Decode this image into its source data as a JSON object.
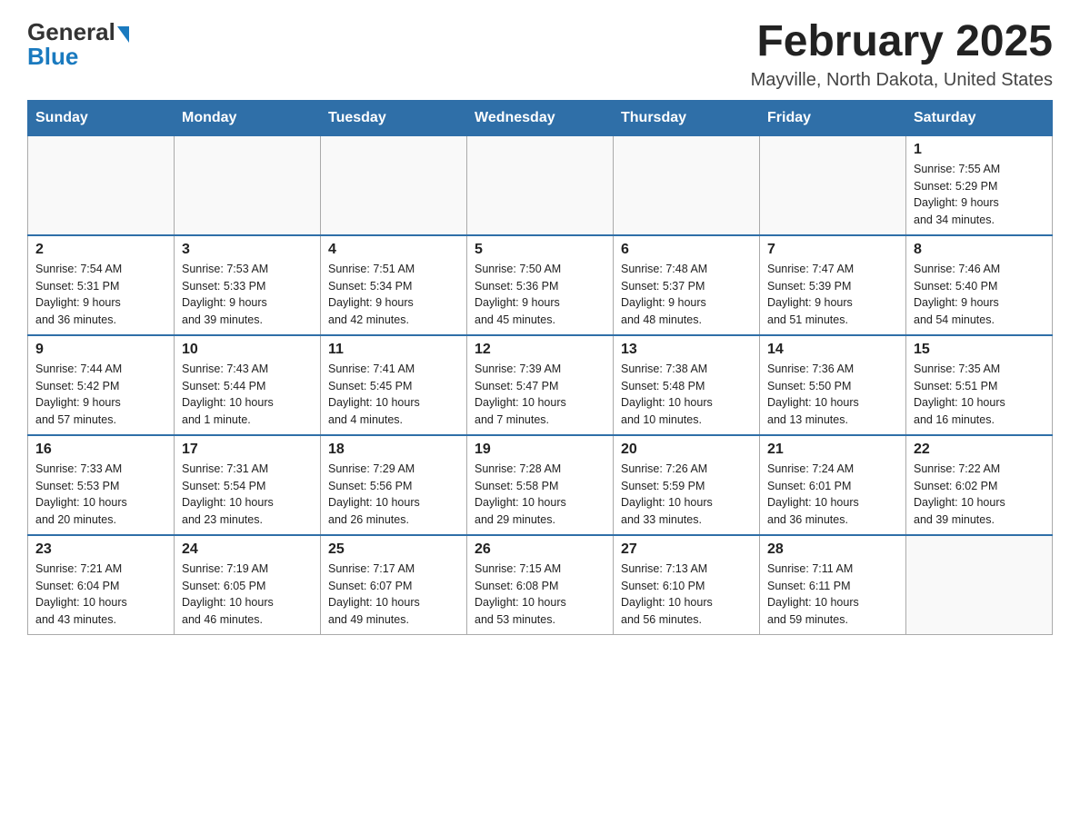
{
  "header": {
    "logo_line1": "General",
    "logo_line2": "Blue",
    "title": "February 2025",
    "location": "Mayville, North Dakota, United States"
  },
  "weekdays": [
    "Sunday",
    "Monday",
    "Tuesday",
    "Wednesday",
    "Thursday",
    "Friday",
    "Saturday"
  ],
  "weeks": [
    [
      {
        "day": "",
        "info": ""
      },
      {
        "day": "",
        "info": ""
      },
      {
        "day": "",
        "info": ""
      },
      {
        "day": "",
        "info": ""
      },
      {
        "day": "",
        "info": ""
      },
      {
        "day": "",
        "info": ""
      },
      {
        "day": "1",
        "info": "Sunrise: 7:55 AM\nSunset: 5:29 PM\nDaylight: 9 hours\nand 34 minutes."
      }
    ],
    [
      {
        "day": "2",
        "info": "Sunrise: 7:54 AM\nSunset: 5:31 PM\nDaylight: 9 hours\nand 36 minutes."
      },
      {
        "day": "3",
        "info": "Sunrise: 7:53 AM\nSunset: 5:33 PM\nDaylight: 9 hours\nand 39 minutes."
      },
      {
        "day": "4",
        "info": "Sunrise: 7:51 AM\nSunset: 5:34 PM\nDaylight: 9 hours\nand 42 minutes."
      },
      {
        "day": "5",
        "info": "Sunrise: 7:50 AM\nSunset: 5:36 PM\nDaylight: 9 hours\nand 45 minutes."
      },
      {
        "day": "6",
        "info": "Sunrise: 7:48 AM\nSunset: 5:37 PM\nDaylight: 9 hours\nand 48 minutes."
      },
      {
        "day": "7",
        "info": "Sunrise: 7:47 AM\nSunset: 5:39 PM\nDaylight: 9 hours\nand 51 minutes."
      },
      {
        "day": "8",
        "info": "Sunrise: 7:46 AM\nSunset: 5:40 PM\nDaylight: 9 hours\nand 54 minutes."
      }
    ],
    [
      {
        "day": "9",
        "info": "Sunrise: 7:44 AM\nSunset: 5:42 PM\nDaylight: 9 hours\nand 57 minutes."
      },
      {
        "day": "10",
        "info": "Sunrise: 7:43 AM\nSunset: 5:44 PM\nDaylight: 10 hours\nand 1 minute."
      },
      {
        "day": "11",
        "info": "Sunrise: 7:41 AM\nSunset: 5:45 PM\nDaylight: 10 hours\nand 4 minutes."
      },
      {
        "day": "12",
        "info": "Sunrise: 7:39 AM\nSunset: 5:47 PM\nDaylight: 10 hours\nand 7 minutes."
      },
      {
        "day": "13",
        "info": "Sunrise: 7:38 AM\nSunset: 5:48 PM\nDaylight: 10 hours\nand 10 minutes."
      },
      {
        "day": "14",
        "info": "Sunrise: 7:36 AM\nSunset: 5:50 PM\nDaylight: 10 hours\nand 13 minutes."
      },
      {
        "day": "15",
        "info": "Sunrise: 7:35 AM\nSunset: 5:51 PM\nDaylight: 10 hours\nand 16 minutes."
      }
    ],
    [
      {
        "day": "16",
        "info": "Sunrise: 7:33 AM\nSunset: 5:53 PM\nDaylight: 10 hours\nand 20 minutes."
      },
      {
        "day": "17",
        "info": "Sunrise: 7:31 AM\nSunset: 5:54 PM\nDaylight: 10 hours\nand 23 minutes."
      },
      {
        "day": "18",
        "info": "Sunrise: 7:29 AM\nSunset: 5:56 PM\nDaylight: 10 hours\nand 26 minutes."
      },
      {
        "day": "19",
        "info": "Sunrise: 7:28 AM\nSunset: 5:58 PM\nDaylight: 10 hours\nand 29 minutes."
      },
      {
        "day": "20",
        "info": "Sunrise: 7:26 AM\nSunset: 5:59 PM\nDaylight: 10 hours\nand 33 minutes."
      },
      {
        "day": "21",
        "info": "Sunrise: 7:24 AM\nSunset: 6:01 PM\nDaylight: 10 hours\nand 36 minutes."
      },
      {
        "day": "22",
        "info": "Sunrise: 7:22 AM\nSunset: 6:02 PM\nDaylight: 10 hours\nand 39 minutes."
      }
    ],
    [
      {
        "day": "23",
        "info": "Sunrise: 7:21 AM\nSunset: 6:04 PM\nDaylight: 10 hours\nand 43 minutes."
      },
      {
        "day": "24",
        "info": "Sunrise: 7:19 AM\nSunset: 6:05 PM\nDaylight: 10 hours\nand 46 minutes."
      },
      {
        "day": "25",
        "info": "Sunrise: 7:17 AM\nSunset: 6:07 PM\nDaylight: 10 hours\nand 49 minutes."
      },
      {
        "day": "26",
        "info": "Sunrise: 7:15 AM\nSunset: 6:08 PM\nDaylight: 10 hours\nand 53 minutes."
      },
      {
        "day": "27",
        "info": "Sunrise: 7:13 AM\nSunset: 6:10 PM\nDaylight: 10 hours\nand 56 minutes."
      },
      {
        "day": "28",
        "info": "Sunrise: 7:11 AM\nSunset: 6:11 PM\nDaylight: 10 hours\nand 59 minutes."
      },
      {
        "day": "",
        "info": ""
      }
    ]
  ]
}
